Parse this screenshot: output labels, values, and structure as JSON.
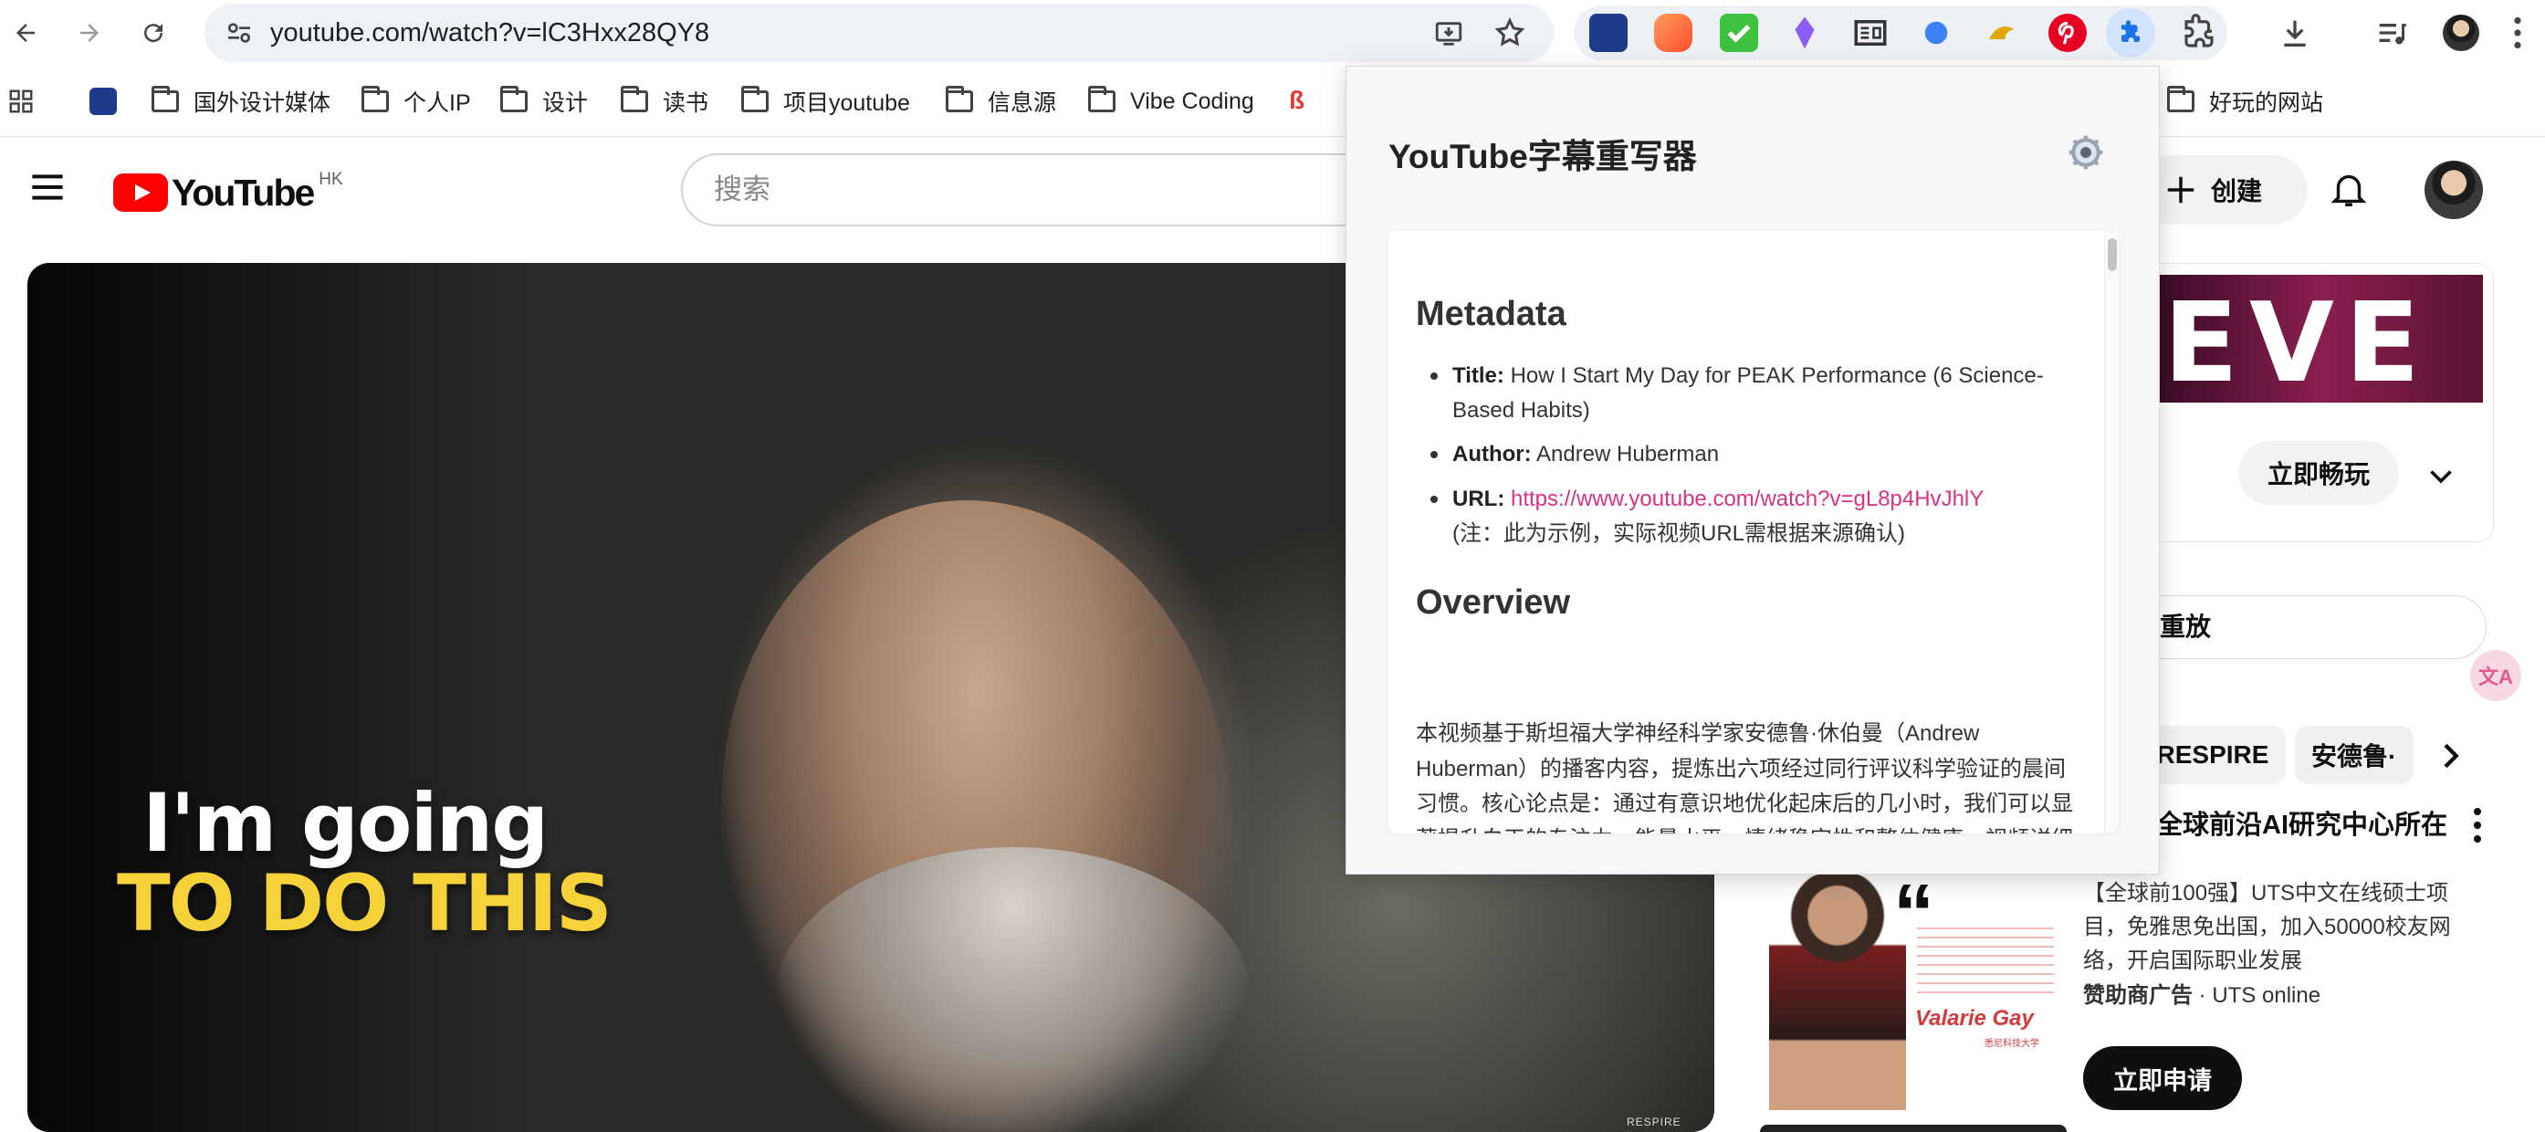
{
  "browser": {
    "url": "youtube.com/watch?v=lC3Hxx28QY8",
    "bookmarks": [
      "国外设计媒体",
      "个人IP",
      "设计",
      "读书",
      "项目youtube",
      "信息源",
      "Vibe Coding",
      "好玩的网站"
    ]
  },
  "youtube": {
    "logo_text": "YouTube",
    "region": "HK",
    "search_placeholder": "搜索",
    "create_label": "创建",
    "caption_line1": "I'm going",
    "caption_line2": "TO DO THIS",
    "watermark": "RESPIRE",
    "ad_banner_text": "EVE",
    "play_now_label": "立即畅玩",
    "replay_label": "重放",
    "chips": [
      "RESPIRE",
      "安德鲁·"
    ],
    "sponsored": {
      "title": "全球前沿AI研究中心所在",
      "description": "【全球前100强】UTS中文在线硕士项目，免雅思免出国，加入50000校友网络，开启国际职业发展",
      "sponsor_label": "赞助商广告",
      "sponsor_name": "UTS online",
      "apply_label": "立即申请",
      "thumb_name": "Valarie Gay",
      "thumb_sub": "悉尼科技大学"
    }
  },
  "popup": {
    "title": "YouTube字幕重写器",
    "metadata_heading": "Metadata",
    "title_label": "Title:",
    "title_value": "How I Start My Day for PEAK Performance (6 Science-Based Habits)",
    "author_label": "Author:",
    "author_value": "Andrew Huberman",
    "url_label": "URL:",
    "url_value": "https://www.youtube.com/watch?v=gL8p4HvJhlY",
    "url_note": "(注：此为示例，实际视频URL需根据来源确认)",
    "overview_heading": "Overview",
    "overview_text": "本视频基于斯坦福大学神经科学家安德鲁·休伯曼（Andrew Huberman）的播客内容，提炼出六项经过同行评议科学验证的晨间习惯。核心论点是：通过有意识地优化起床后的几小时，我们可以显著提升白天的专注力、能量水平、情绪稳定性和整体健康。视频详细阐述了从醒来那一刻到开始工作的过程中，如何利用神经生"
  },
  "colors": {
    "youtube_red": "#ff0000",
    "link_pink": "#d63384",
    "caption_yellow": "#f5d13a"
  }
}
